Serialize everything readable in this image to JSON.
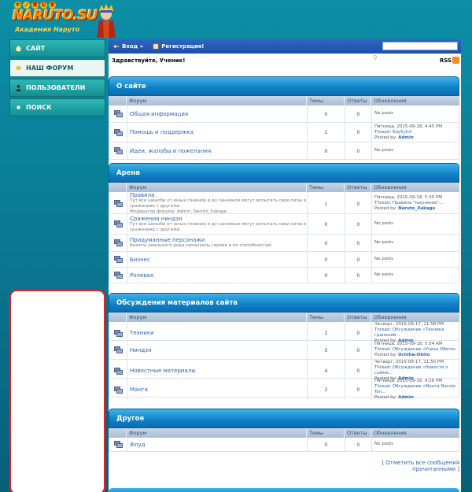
{
  "logo": {
    "kanji": [
      "木",
      "ノ",
      "葉",
      "忍",
      "者"
    ],
    "main": "NARUTO.SU",
    "sub": "Академия Наруто"
  },
  "nav": [
    {
      "label": "САЙТ",
      "icon": "home-icon"
    },
    {
      "label": "НАШ ФОРУМ",
      "icon": "forum-icon"
    },
    {
      "label": "ПОЛЬЗОВАТЕЛИ",
      "icon": "users-icon"
    },
    {
      "label": "ПОИСК",
      "icon": "search-icon"
    }
  ],
  "topbar": {
    "login": "Вход »",
    "register": "Регистрация!",
    "search_placeholder": ""
  },
  "greeting": "Здравствуйте, Ученик!",
  "rss": "RSS",
  "columns": {
    "forum": "Форум",
    "topics": "Темы",
    "replies": "Ответы",
    "updates": "Обновления"
  },
  "categories": [
    {
      "title": "О сайте",
      "forums": [
        {
          "name": "Общая информация",
          "desc": "",
          "mod": "",
          "topics": "0",
          "replies": "0",
          "last": {
            "date": "",
            "thread": "",
            "by": "",
            "nopost": "No posts"
          }
        },
        {
          "name": "Помощь и поддержка",
          "desc": "",
          "mod": "",
          "topics": "1",
          "replies": "0",
          "last": {
            "date": "Пятница, 2015-09-18, 4:45 PM",
            "thread": "Thread: 6dy5yhrf",
            "by": "Admin",
            "nopost": ""
          }
        },
        {
          "name": "Идеи, жалобы и пожелания",
          "desc": "",
          "mod": "",
          "topics": "0",
          "replies": "0",
          "last": {
            "date": "",
            "thread": "",
            "by": "",
            "nopost": "No posts"
          }
        }
      ]
    },
    {
      "title": "Арена",
      "forums": [
        {
          "name": "Правила",
          "desc": "Тут все шиноби от юных генинов и до саннинов могут испытать свои силы в сражениях с другими.",
          "mod": "Модератор форума: Admin, Naruto_Xakage",
          "topics": "1",
          "replies": "0",
          "last": {
            "date": "Пятница, 2015-09-18, 5:35 PM",
            "thread": "Thread: Правила \"ниснинов\"...",
            "by": "Naruto_Xakage",
            "nopost": ""
          }
        },
        {
          "name": "Сражения ниндзя",
          "desc": "Тут все шиноби от юных генинов и до саннинов могут испытать свои силы в сражениях с другими.",
          "mod": "",
          "topics": "0",
          "replies": "0",
          "last": {
            "date": "",
            "thread": "",
            "by": "",
            "nopost": "No posts"
          }
        },
        {
          "name": "Придуманные персонажи",
          "desc": "Анкеты реального рода никанкиль героев и их способностей.",
          "mod": "",
          "topics": "0",
          "replies": "0",
          "last": {
            "date": "",
            "thread": "",
            "by": "",
            "nopost": "No posts"
          }
        },
        {
          "name": "Бизнес",
          "desc": "",
          "mod": "",
          "topics": "0",
          "replies": "0",
          "last": {
            "date": "",
            "thread": "",
            "by": "",
            "nopost": "No posts"
          }
        },
        {
          "name": "Ролевая",
          "desc": "",
          "mod": "",
          "topics": "0",
          "replies": "0",
          "last": {
            "date": "",
            "thread": "",
            "by": "",
            "nopost": "No posts"
          }
        }
      ]
    },
    {
      "title": "Обсуждения материалов сайта",
      "forums": [
        {
          "name": "Техники",
          "desc": "",
          "mod": "",
          "topics": "2",
          "replies": "0",
          "last": {
            "date": "Четверг, 2015-09-17, 11:58 PM",
            "thread": "Thread: Обсуждение «Техника гранений...",
            "by": "Admin",
            "nopost": ""
          }
        },
        {
          "name": "Ниндзя",
          "desc": "",
          "mod": "",
          "topics": "5",
          "replies": "0",
          "last": {
            "date": "Пятница, 2015-09-18, 0:54 AM",
            "thread": "Thread: Обсуждение «Учиха Обито»",
            "by": "Uchiha-Obito",
            "nopost": ""
          }
        },
        {
          "name": "Новостные материалы",
          "desc": "",
          "mod": "",
          "topics": "4",
          "replies": "0",
          "last": {
            "date": "Четверг, 2015-09-17, 11:50 PM",
            "thread": "Thread: Обсуждение «Новости о съёмк...",
            "by": "Admin",
            "nopost": ""
          }
        },
        {
          "name": "Манга",
          "desc": "",
          "mod": "",
          "topics": "2",
          "replies": "0",
          "last": {
            "date": "Пятница, 2015-09-18, 4:26 PM",
            "thread": "Thread: Обсуждение «Манга Naruto Ton...",
            "by": "Admin",
            "nopost": ""
          }
        }
      ]
    },
    {
      "title": "Другое",
      "forums": [
        {
          "name": "Флуд",
          "desc": "",
          "mod": "",
          "topics": "0",
          "replies": "0",
          "last": {
            "date": "",
            "thread": "",
            "by": "",
            "nopost": "No posts"
          }
        }
      ]
    }
  ],
  "mark_all": "[ Отметить все сообщения прочитанными ]",
  "posted_by": "Posted by:",
  "colors": {
    "accent": "#0f7fc5",
    "link": "#2a64b5",
    "sidebar": "#138f93"
  }
}
